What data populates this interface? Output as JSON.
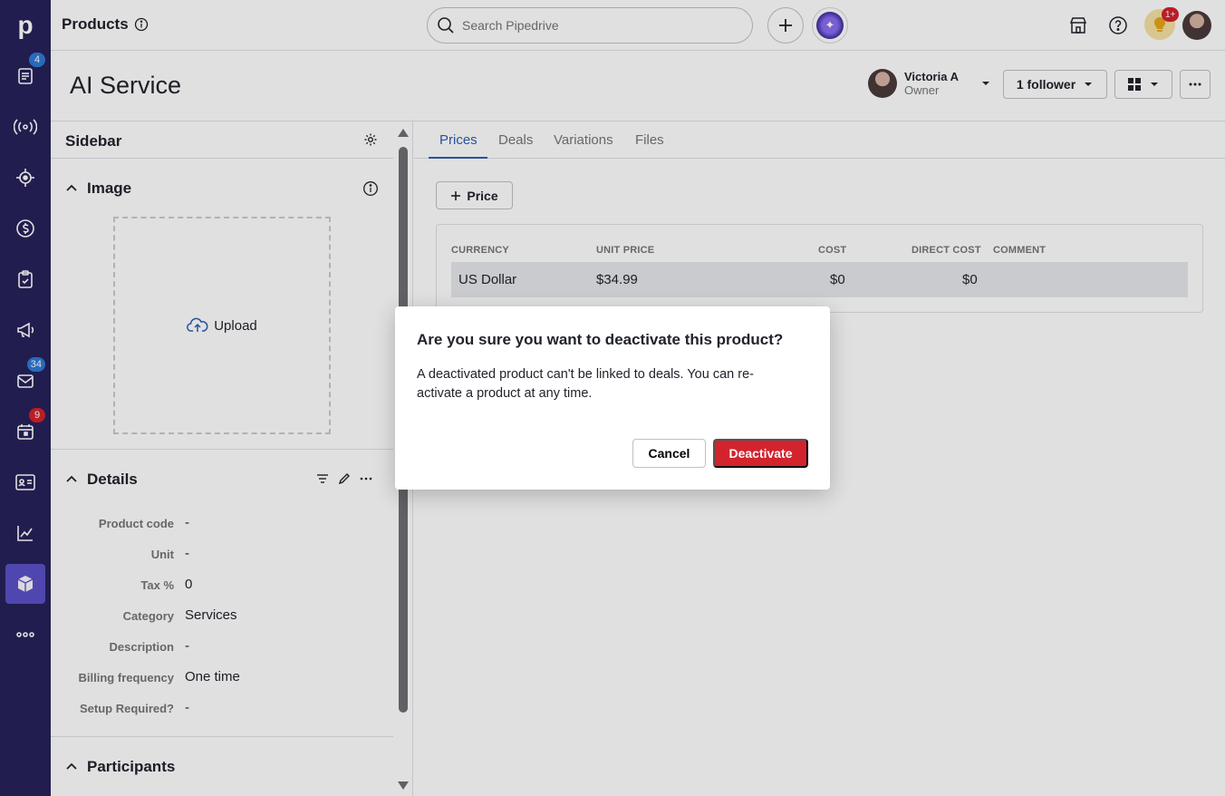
{
  "app": {
    "title": "Products",
    "logo_letter": "p"
  },
  "nav": {
    "items": [
      {
        "icon": "leads-icon",
        "badge": "4",
        "badge_color": "#2e79d6"
      },
      {
        "icon": "deals-icon",
        "badge": null
      },
      {
        "icon": "pipeline-icon",
        "badge": null
      },
      {
        "icon": "dollar-icon",
        "badge": null
      },
      {
        "icon": "activities-icon",
        "badge": null
      },
      {
        "icon": "campaigns-icon",
        "badge": null
      },
      {
        "icon": "mail-icon",
        "badge": "34",
        "badge_color": "#2e79d6"
      },
      {
        "icon": "calendar-icon",
        "badge": "9",
        "badge_color": "#d3232c"
      },
      {
        "icon": "contacts-icon",
        "badge": null
      },
      {
        "icon": "insights-icon",
        "badge": null
      },
      {
        "icon": "products-icon",
        "badge": null,
        "active": true
      },
      {
        "icon": "more-icon",
        "badge": null
      }
    ]
  },
  "topbar": {
    "search_placeholder": "Search Pipedrive",
    "notification_badge": "1+"
  },
  "header": {
    "title": "AI Service",
    "owner_name": "Victoria A",
    "owner_role": "Owner",
    "follower_label": "1 follower"
  },
  "sidebar": {
    "title": "Sidebar",
    "image_section": "Image",
    "upload_label": "Upload",
    "details_section": "Details",
    "details": [
      {
        "label": "Product code",
        "value": "-"
      },
      {
        "label": "Unit",
        "value": "-"
      },
      {
        "label": "Tax %",
        "value": "0"
      },
      {
        "label": "Category",
        "value": "Services"
      },
      {
        "label": "Description",
        "value": "-"
      },
      {
        "label": "Billing frequency",
        "value": "One time"
      },
      {
        "label": "Setup Required?",
        "value": "-"
      }
    ],
    "participants_section": "Participants"
  },
  "main": {
    "tabs": [
      "Prices",
      "Deals",
      "Variations",
      "Files"
    ],
    "active_tab": "Prices",
    "add_price_label": "Price",
    "table": {
      "headers": [
        "CURRENCY",
        "UNIT PRICE",
        "COST",
        "DIRECT COST",
        "COMMENT"
      ],
      "rows": [
        {
          "currency": "US Dollar",
          "unit_price": "$34.99",
          "cost": "$0",
          "direct_cost": "$0",
          "comment": ""
        }
      ]
    }
  },
  "modal": {
    "title": "Are you sure you want to deactivate this product?",
    "body": "A deactivated product can't be linked to deals. You can re-activate a product at any time.",
    "cancel_label": "Cancel",
    "confirm_label": "Deactivate",
    "confirm_color": "#d3232c"
  },
  "colors": {
    "nav_bg": "#26225a",
    "nav_active": "#5c50c8",
    "accent": "#2a5fb0"
  }
}
